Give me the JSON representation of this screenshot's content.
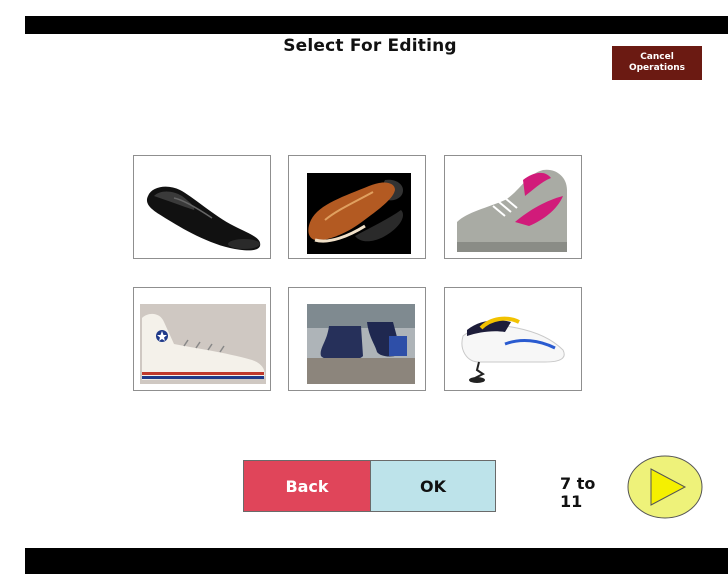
{
  "header": {
    "title": "Select For Editing",
    "cancel_label": "Cancel\nOperations"
  },
  "grid": {
    "items": [
      {
        "name": "black leather loafer"
      },
      {
        "name": "brown boat shoe"
      },
      {
        "name": "grey pink basketball sneaker"
      },
      {
        "name": "white high-top sneaker"
      },
      {
        "name": "blue boots outdoors"
      },
      {
        "name": "white spring running shoe"
      }
    ]
  },
  "footer": {
    "back_label": "Back",
    "ok_label": "OK",
    "page_counter": "7 to\n11",
    "next_icon": "play-triangle-icon"
  },
  "colors": {
    "cancel_bg": "#6b1a12",
    "back_bg": "#e0455a",
    "ok_bg": "#bde3ea",
    "next_bg": "#eef27a",
    "next_triangle": "#f5f000"
  }
}
